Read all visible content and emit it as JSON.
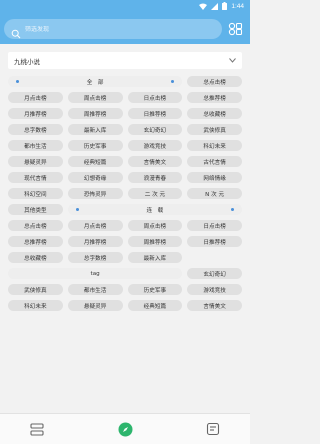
{
  "status_bar": {
    "time": "1:44"
  },
  "search": {
    "placeholder": "筛选发现"
  },
  "source": {
    "selected": "九桃小说"
  },
  "sections": [
    {
      "header": "全　部",
      "header_dots": true,
      "items": [
        "总点击榜",
        "月点击榜",
        "周点击榜",
        "日点击榜",
        "总推荐榜",
        "月推荐榜",
        "周推荐榜",
        "日推荐榜",
        "总收藏榜",
        "总字数榜",
        "最新入库",
        "玄幻奇幻",
        "武侠修真",
        "都市生活",
        "历史军事",
        "游戏竞技",
        "科幻未来",
        "悬疑灵异",
        "经典短篇",
        "言情美文",
        "古代言情",
        "现代言情",
        "幻想奇缘",
        "浪漫青春",
        "网络情缘",
        "科幻空间",
        "恐怖灵异",
        "二 次 元",
        "N 次 元",
        "其他类型"
      ]
    },
    {
      "header": "连　载",
      "header_dots": true,
      "items": [
        "总点击榜",
        "月点击榜",
        "周点击榜",
        "日点击榜",
        "总推荐榜",
        "月推荐榜",
        "周推荐榜",
        "日推荐榜",
        "总收藏榜",
        "总字数榜",
        "最新入库"
      ]
    },
    {
      "header": "tag",
      "header_dots": false,
      "items": [
        "玄幻奇幻",
        "武侠修真",
        "都市生活",
        "历史军事",
        "游戏竞技",
        "科幻未来",
        "悬疑灵异",
        "经典短篇",
        "言情美文"
      ]
    }
  ],
  "colors": {
    "accent": "#5fb3ea",
    "chip": "#e0e0e0",
    "active_tab": "#2db56d"
  }
}
